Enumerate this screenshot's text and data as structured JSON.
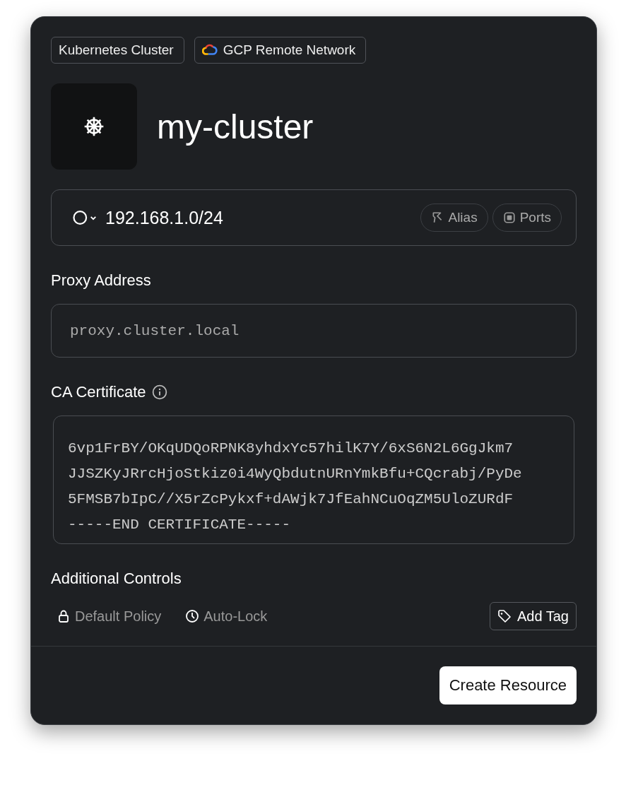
{
  "tags": [
    {
      "label": "Kubernetes Cluster",
      "kind": "plain"
    },
    {
      "label": "GCP Remote Network",
      "kind": "cloud"
    }
  ],
  "title": "my-cluster",
  "address": {
    "value": "192.168.1.0/24",
    "actions": [
      {
        "label": "Alias",
        "kind": "alias"
      },
      {
        "label": "Ports",
        "kind": "ports"
      }
    ]
  },
  "proxy": {
    "label": "Proxy Address",
    "placeholder": "proxy.cluster.local"
  },
  "certificate": {
    "label": "CA Certificate",
    "lines": [
      "6vp1FrBY/OKqUDQoRPNK8yhdxYc57hilK7Y/6xS6N2L6GgJkm7",
      "JJSZKyJRrcHjoStkiz0i4WyQbdutnURnYmkBfu+CQcrabj/PyDe",
      "5FMSB7bIpC//X5rZcPykxf+dAWjk7JfEahNCuOqZM5UloZURdF",
      "-----END CERTIFICATE-----"
    ]
  },
  "additional": {
    "label": "Additional Controls",
    "options": [
      {
        "label": "Default Policy",
        "kind": "lock"
      },
      {
        "label": "Auto-Lock",
        "kind": "clock"
      }
    ],
    "tag_button": "Add Tag"
  },
  "submit": "Create Resource"
}
